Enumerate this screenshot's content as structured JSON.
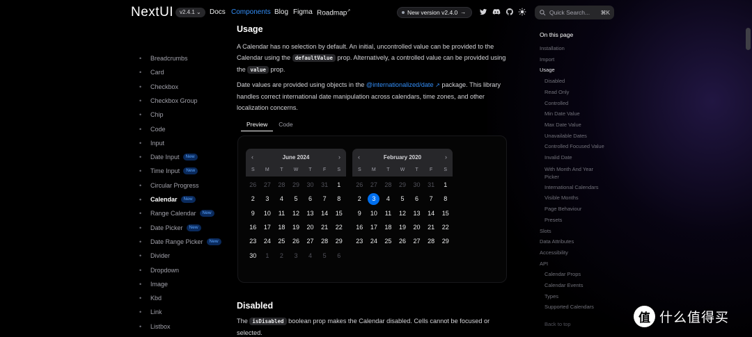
{
  "navbar": {
    "logo": "NextUI",
    "version": "v2.4.1",
    "links": [
      "Docs",
      "Components",
      "Blog",
      "Figma",
      "Roadmap"
    ],
    "active_link": "Components",
    "new_version_label": "New version v2.4.0",
    "search_placeholder": "Quick Search...",
    "search_shortcut": "⌘K",
    "icons": [
      "twitter-icon",
      "discord-icon",
      "github-icon",
      "theme-toggle-icon"
    ]
  },
  "sidebar": {
    "items": [
      {
        "label": "Breadcrumbs",
        "badge": ""
      },
      {
        "label": "Card",
        "badge": ""
      },
      {
        "label": "Checkbox",
        "badge": ""
      },
      {
        "label": "Checkbox Group",
        "badge": ""
      },
      {
        "label": "Chip",
        "badge": ""
      },
      {
        "label": "Code",
        "badge": ""
      },
      {
        "label": "Input",
        "badge": ""
      },
      {
        "label": "Date Input",
        "badge": "New"
      },
      {
        "label": "Time Input",
        "badge": "New"
      },
      {
        "label": "Circular Progress",
        "badge": ""
      },
      {
        "label": "Calendar",
        "badge": "New"
      },
      {
        "label": "Range Calendar",
        "badge": "New"
      },
      {
        "label": "Date Picker",
        "badge": "New"
      },
      {
        "label": "Date Range Picker",
        "badge": "New"
      },
      {
        "label": "Divider",
        "badge": ""
      },
      {
        "label": "Dropdown",
        "badge": ""
      },
      {
        "label": "Image",
        "badge": ""
      },
      {
        "label": "Kbd",
        "badge": ""
      },
      {
        "label": "Link",
        "badge": ""
      },
      {
        "label": "Listbox",
        "badge": ""
      }
    ],
    "active_item": "Calendar"
  },
  "main": {
    "usage_heading": "Usage",
    "usage_p1_a": "A Calendar has no selection by default. An initial, uncontrolled value can be provided to the Calendar using the",
    "usage_p1_code1": "defaultValue",
    "usage_p1_b": "prop. Alternatively, a controlled value can be provided using the",
    "usage_p1_code2": "value",
    "usage_p1_c": "prop.",
    "usage_p2_a": "Date values are provided using objects in the",
    "usage_p2_link": "@internationalized/date",
    "usage_p2_b": "package. This library handles correct international date manipulation across calendars, time zones, and other localization concerns.",
    "tabs": [
      "Preview",
      "Code"
    ],
    "active_tab": "Preview",
    "disabled_heading": "Disabled",
    "disabled_p_a": "The",
    "disabled_p_code": "isDisabled",
    "disabled_p_b": "boolean prop makes the Calendar disabled. Cells cannot be focused or selected."
  },
  "calendars": [
    {
      "month_label": "June 2024",
      "weekdays": [
        "S",
        "M",
        "T",
        "W",
        "T",
        "F",
        "S"
      ],
      "days": [
        [
          26,
          27,
          28,
          29,
          30,
          31,
          1
        ],
        [
          2,
          3,
          4,
          5,
          6,
          7,
          8
        ],
        [
          9,
          10,
          11,
          12,
          13,
          14,
          15
        ],
        [
          16,
          17,
          18,
          19,
          20,
          21,
          22
        ],
        [
          23,
          24,
          25,
          26,
          27,
          28,
          29
        ],
        [
          30,
          1,
          2,
          3,
          4,
          5,
          6
        ]
      ],
      "outside": [
        [
          0,
          0
        ],
        [
          0,
          1
        ],
        [
          0,
          2
        ],
        [
          0,
          3
        ],
        [
          0,
          4
        ],
        [
          0,
          5
        ],
        [
          5,
          1
        ],
        [
          5,
          2
        ],
        [
          5,
          3
        ],
        [
          5,
          4
        ],
        [
          5,
          5
        ],
        [
          5,
          6
        ]
      ],
      "selected": null
    },
    {
      "month_label": "February 2020",
      "weekdays": [
        "S",
        "M",
        "T",
        "W",
        "T",
        "F",
        "S"
      ],
      "days": [
        [
          26,
          27,
          28,
          29,
          30,
          31,
          1
        ],
        [
          2,
          3,
          4,
          5,
          6,
          7,
          8
        ],
        [
          9,
          10,
          11,
          12,
          13,
          14,
          15
        ],
        [
          16,
          17,
          18,
          19,
          20,
          21,
          22
        ],
        [
          23,
          24,
          25,
          26,
          27,
          28,
          29
        ]
      ],
      "outside": [
        [
          0,
          0
        ],
        [
          0,
          1
        ],
        [
          0,
          2
        ],
        [
          0,
          3
        ],
        [
          0,
          4
        ],
        [
          0,
          5
        ]
      ],
      "selected": [
        1,
        1
      ]
    }
  ],
  "toc": {
    "title": "On this page",
    "items": [
      {
        "label": "Installation",
        "level": 1,
        "active": false
      },
      {
        "label": "Import",
        "level": 1,
        "active": false
      },
      {
        "label": "Usage",
        "level": 1,
        "active": true
      },
      {
        "label": "Disabled",
        "level": 2,
        "active": false
      },
      {
        "label": "Read Only",
        "level": 2,
        "active": false
      },
      {
        "label": "Controlled",
        "level": 2,
        "active": false
      },
      {
        "label": "Min Date Value",
        "level": 2,
        "active": false
      },
      {
        "label": "Max Date Value",
        "level": 2,
        "active": false
      },
      {
        "label": "Unavailable Dates",
        "level": 2,
        "active": false
      },
      {
        "label": "Controlled Focused Value",
        "level": 2,
        "active": false
      },
      {
        "label": "Invalid Date",
        "level": 2,
        "active": false
      },
      {
        "label": "With Month And Year Picker",
        "level": 2,
        "active": false,
        "wrap": true
      },
      {
        "label": "International Calendars",
        "level": 2,
        "active": false
      },
      {
        "label": "Visible Months",
        "level": 2,
        "active": false
      },
      {
        "label": "Page Behaviour",
        "level": 2,
        "active": false
      },
      {
        "label": "Presets",
        "level": 2,
        "active": false
      },
      {
        "label": "Slots",
        "level": 1,
        "active": false
      },
      {
        "label": "Data Attributes",
        "level": 1,
        "active": false
      },
      {
        "label": "Accessibility",
        "level": 1,
        "active": false
      },
      {
        "label": "API",
        "level": 1,
        "active": false
      },
      {
        "label": "Calendar Props",
        "level": 2,
        "active": false
      },
      {
        "label": "Calendar Events",
        "level": 2,
        "active": false
      },
      {
        "label": "Types",
        "level": 2,
        "active": false
      },
      {
        "label": "Supported Calendars",
        "level": 2,
        "active": false
      },
      {
        "label": "Back to top",
        "level": 2,
        "active": false
      }
    ]
  },
  "watermark": {
    "symbol": "值",
    "text": "什么值得买"
  },
  "colors": {
    "accent": "#338ef7",
    "selected_day": "#006fee",
    "background": "#000000"
  }
}
